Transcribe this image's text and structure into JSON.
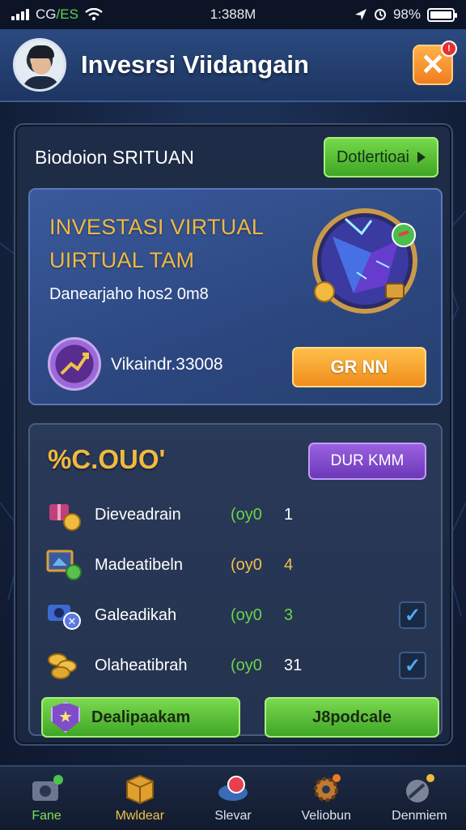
{
  "status_bar": {
    "carrier_prefix": "CG",
    "carrier_sep": "/",
    "carrier_suffix": "ES",
    "time": "1:388M",
    "battery": "98%"
  },
  "header": {
    "title": "Invesrsi Viidangain",
    "close_label": "✕",
    "badge": "!"
  },
  "panel": {
    "title": "Biodoion SRITUAN",
    "action_label": "Dotlertioai"
  },
  "promo": {
    "title_line1": "INVESTASI VIRTUAL",
    "title_line2": "UIRTUAL TAM",
    "subtitle": "Danearjaho hos2 0m8",
    "amount": "Vikaindr.33008",
    "button_label": "GR NN"
  },
  "rewards": {
    "value": "%C.OUO'",
    "button_label": "DUR KMM",
    "rows": [
      {
        "name": "Dieveadrain",
        "ratio": "(oy0",
        "count": "1",
        "ratio_color": "green",
        "checked": false,
        "icon": "gift-coins-icon"
      },
      {
        "name": "Madeatibeln",
        "ratio": "(oy0",
        "count": "4",
        "ratio_color": "yellow",
        "checked": false,
        "icon": "picture-frame-icon"
      },
      {
        "name": "Galeadikah",
        "ratio": "(oy0",
        "count": "3",
        "ratio_color": "green",
        "checked": true,
        "icon": "camera-badge-icon"
      },
      {
        "name": "Olaheatibrah",
        "ratio": "(oy0",
        "count": "31",
        "ratio_color": "green",
        "checked": true,
        "icon": "gold-coins-icon"
      }
    ],
    "left_button_label": "Dealipaakam",
    "right_button_label": "J8podcale"
  },
  "nav": [
    {
      "label": "Fane",
      "icon": "camera-icon"
    },
    {
      "label": "Mwldear",
      "icon": "box-icon"
    },
    {
      "label": "Slevar",
      "icon": "globe-icon"
    },
    {
      "label": "Veliobun",
      "icon": "gear-icon"
    },
    {
      "label": "Denmiem",
      "icon": "satellite-icon"
    }
  ],
  "colors": {
    "accent_gold": "#f0b940",
    "green": "#5fc43a",
    "orange": "#f59a2a",
    "purple": "#8452cf",
    "panel": "#1e2c47"
  }
}
